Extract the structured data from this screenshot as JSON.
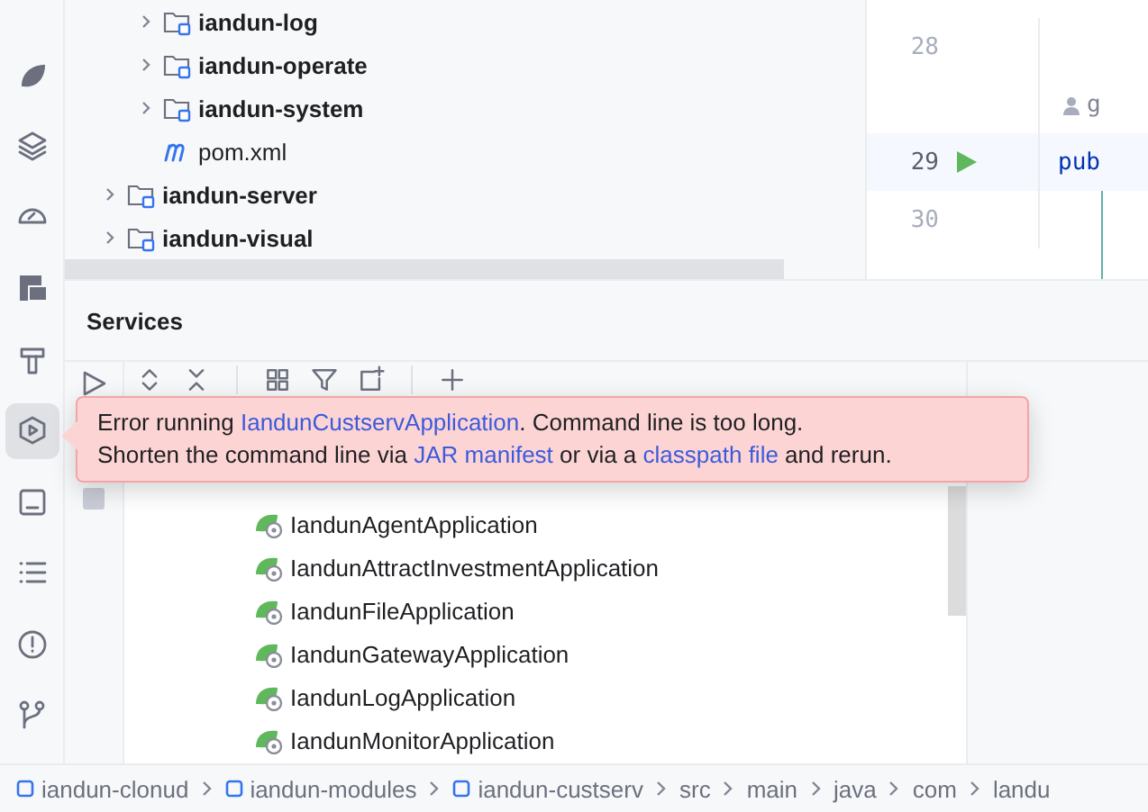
{
  "tool_strip": [
    {
      "kind": "leaf",
      "selected": false
    },
    {
      "kind": "layers",
      "selected": false
    },
    {
      "kind": "gauge",
      "selected": false
    },
    {
      "kind": "ee",
      "selected": false
    },
    {
      "kind": "hammer",
      "selected": false
    },
    {
      "kind": "services",
      "selected": true
    },
    {
      "kind": "terminal",
      "selected": false
    },
    {
      "kind": "list",
      "selected": false
    },
    {
      "kind": "problems",
      "selected": false
    },
    {
      "kind": "git",
      "selected": false
    }
  ],
  "project_tree": [
    {
      "children": [
        {
          "label": "iandun-log",
          "kind": "module",
          "expanded": false,
          "selected": false
        },
        {
          "label": "iandun-operate",
          "kind": "module",
          "expanded": false,
          "selected": false
        },
        {
          "label": "iandun-system",
          "kind": "module",
          "expanded": false,
          "selected": false
        },
        {
          "label": "pom.xml",
          "kind": "maven",
          "selected": false
        }
      ]
    },
    {
      "label": "iandun-server",
      "kind": "module",
      "expanded": false,
      "selected": false
    },
    {
      "label": "iandun-visual",
      "kind": "module",
      "expanded": false,
      "selected": false
    },
    {
      "selected": true
    }
  ],
  "editor": {
    "lines": [
      {
        "kind": "code",
        "number": "28",
        "current": false,
        "run": false
      },
      {
        "kind": "inlay",
        "text": "g"
      },
      {
        "kind": "code",
        "number": "29",
        "text": "pub",
        "current": true,
        "run": true
      },
      {
        "kind": "code",
        "number": "30",
        "current": false,
        "run": false
      }
    ]
  },
  "services": {
    "title": "Services",
    "tree": [
      {
        "label": "IandunAgentApplication"
      },
      {
        "label": "IandunAttractInvestmentApplication"
      },
      {
        "label": "IandunFileApplication"
      },
      {
        "label": "IandunGatewayApplication"
      },
      {
        "label": "IandunLogApplication"
      },
      {
        "label": "IandunMonitorApplication"
      }
    ]
  },
  "error_balloon": {
    "lines": [
      [
        {
          "text": "Error running ",
          "link": false
        },
        {
          "text": "IandunCustservApplication",
          "link": true
        },
        {
          "text": ". Command line is too long.",
          "link": false
        }
      ],
      [
        {
          "text": "Shorten the command line via ",
          "link": false
        },
        {
          "text": "JAR manifest",
          "link": true
        },
        {
          "text": " or via a ",
          "link": false
        },
        {
          "text": "classpath file",
          "link": true
        },
        {
          "text": " and rerun.",
          "link": false
        }
      ]
    ]
  },
  "breadcrumb": [
    {
      "label": "iandun-clonud",
      "kind": "module"
    },
    {
      "label": "iandun-modules",
      "kind": "module"
    },
    {
      "label": "iandun-custserv",
      "kind": "module"
    },
    {
      "label": "src",
      "kind": "plain"
    },
    {
      "label": "main",
      "kind": "plain"
    },
    {
      "label": "java",
      "kind": "plain"
    },
    {
      "label": "com",
      "kind": "plain"
    },
    {
      "label": "landu",
      "kind": "plain"
    }
  ]
}
